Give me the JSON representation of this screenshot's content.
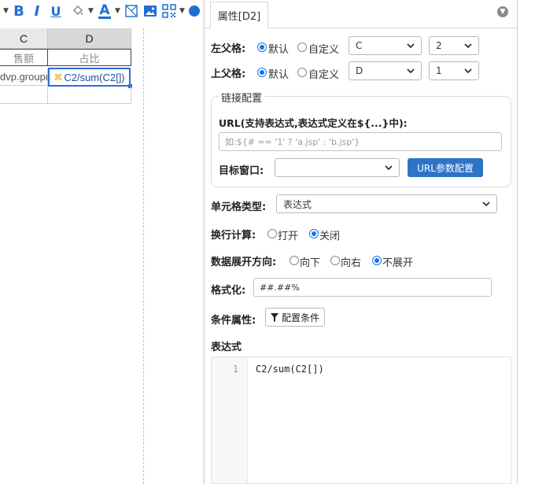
{
  "toolbar": {
    "icons": [
      "bold-icon",
      "italic-icon",
      "underline-icon",
      "fill-color-icon",
      "font-color-icon",
      "border-icon",
      "image-icon",
      "qrcode-icon"
    ],
    "bold": "B",
    "italic": "I",
    "underline": "U",
    "font_color": "A"
  },
  "sheet": {
    "columns": [
      "C",
      "D"
    ],
    "rows": [
      [
        "售额",
        "占比"
      ],
      [
        "dvp.group(",
        "C2/sum(C2[])"
      ],
      [
        "",
        ""
      ]
    ],
    "selected_cell": "D2",
    "accent": "#2b6fd6"
  },
  "panel": {
    "tab": "属性[D2]",
    "left_parent": {
      "label": "左父格:",
      "option_default": "默认",
      "option_custom": "自定义",
      "selected": "默认",
      "column": "C",
      "row": "2"
    },
    "top_parent": {
      "label": "上父格:",
      "option_default": "默认",
      "option_custom": "自定义",
      "selected": "默认",
      "column": "D",
      "row": "1"
    },
    "link": {
      "legend": "链接配置",
      "url_label": "URL(支持表达式,表达式定义在${...}中):",
      "url_placeholder": "如:${# == '1' ? 'a.jsp' : 'b.jsp'}",
      "target_label": "目标窗口:",
      "target_value": "",
      "param_button": "URL参数配置"
    },
    "cell_type": {
      "label": "单元格类型:",
      "value": "表达式"
    },
    "wrap": {
      "label": "换行计算:",
      "option_on": "打开",
      "option_off": "关闭",
      "selected": "关闭"
    },
    "expand": {
      "label": "数据展开方向:",
      "option_down": "向下",
      "option_right": "向右",
      "option_none": "不展开",
      "selected": "不展开"
    },
    "format": {
      "label": "格式化:",
      "value": "##.##%"
    },
    "condition": {
      "label": "条件属性:",
      "button": "配置条件"
    },
    "expression": {
      "label": "表达式",
      "line_number": "1",
      "code": "C2/sum(C2[])"
    },
    "brand_blue": "#2f73c9"
  }
}
